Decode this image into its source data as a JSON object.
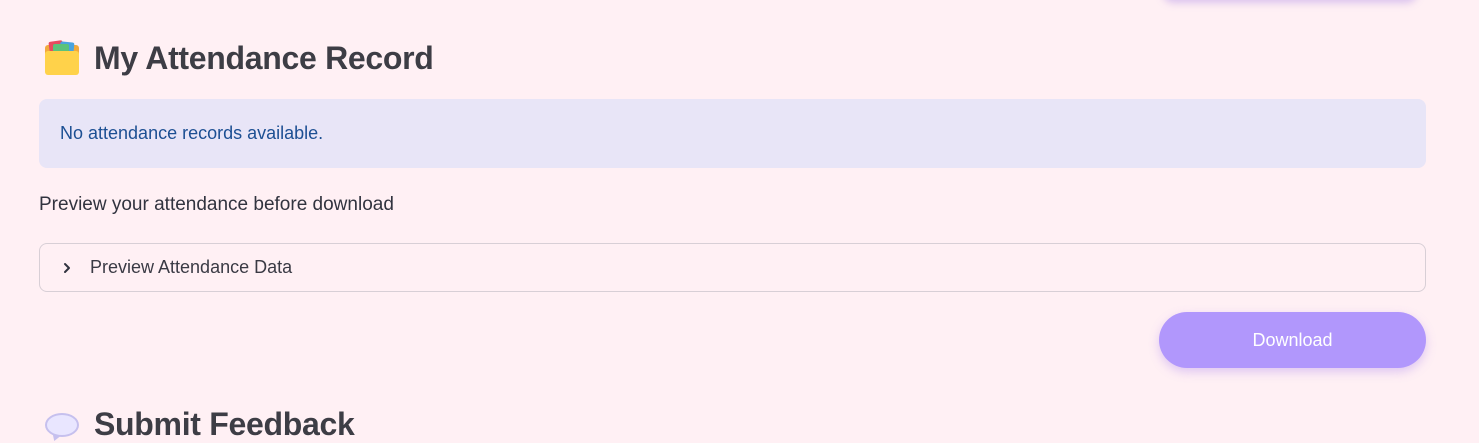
{
  "sections": {
    "attendance": {
      "icon": "card-index-dividers-icon",
      "title": "My Attendance Record"
    },
    "feedback": {
      "icon": "speech-balloon-icon",
      "title": "Submit Feedback"
    }
  },
  "info": {
    "message": "No attendance records available."
  },
  "preview": {
    "label": "Preview your attendance before download",
    "expander_label": "Preview Attendance Data",
    "expander_icon": "chevron-right-icon"
  },
  "download": {
    "label": "Download"
  },
  "colors": {
    "background": "#fff0f4",
    "accent": "#b197fc",
    "info_background": "#e8e5f7",
    "info_text": "#1c4f93"
  }
}
